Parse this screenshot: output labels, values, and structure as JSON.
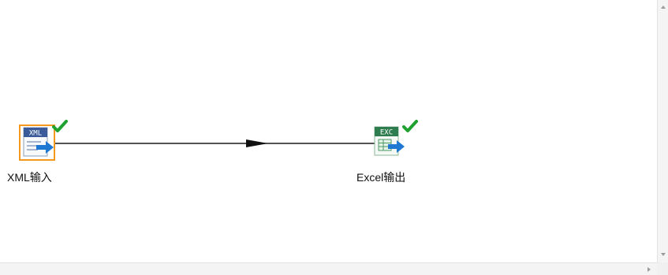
{
  "canvas": {
    "steps": [
      {
        "id": "xml-input",
        "label": "XML输入",
        "icon_text": "XML",
        "icon": "xml-input-icon",
        "status": "ok",
        "selected": true
      },
      {
        "id": "excel-output",
        "label": "Excel输出",
        "icon_text": "EXC",
        "icon": "excel-output-icon",
        "status": "ok",
        "selected": false
      }
    ],
    "hop": {
      "from": "XML输入",
      "to": "Excel输出"
    }
  },
  "colors": {
    "selection": "#f39a1e",
    "check": "#1fa12f",
    "hop": "#1a1a1a",
    "xml_header": "#3b5a9a",
    "excel_header": "#2e7d4f",
    "arrow": "#1f78d1"
  }
}
